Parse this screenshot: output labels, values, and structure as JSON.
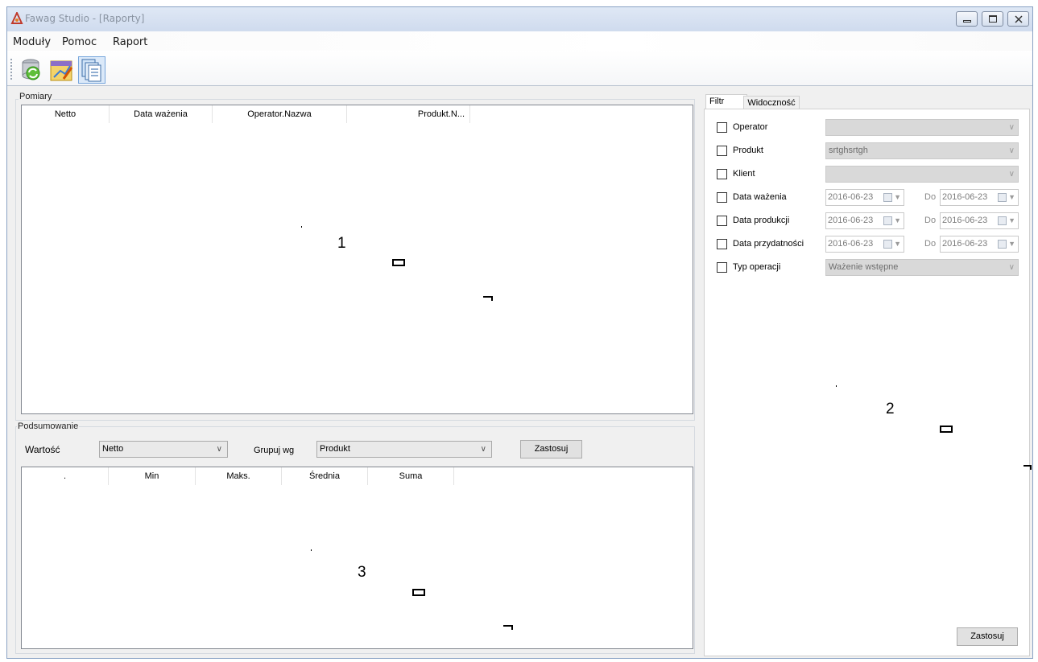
{
  "window": {
    "title": "Fawag Studio - [Raporty]"
  },
  "menu": {
    "items": [
      "Moduły",
      "Pomoc",
      "Raport"
    ]
  },
  "toolbar": {
    "buttons": [
      "refresh-db-icon",
      "report-edit-icon",
      "documents-icon"
    ]
  },
  "pomiary": {
    "title": "Pomiary",
    "columns": [
      "Netto",
      "Data ważenia",
      "Operator.Nazwa",
      "Produkt.N..."
    ]
  },
  "podsumowanie": {
    "title": "Podsumowanie",
    "wartosc_label": "Wartość",
    "wartosc_value": "Netto",
    "grupuj_label": "Grupuj wg",
    "grupuj_value": "Produkt",
    "apply_label": "Zastosuj",
    "columns": [
      ".",
      "Min",
      "Maks.",
      "Średnia",
      "Suma"
    ]
  },
  "filter": {
    "tabs": [
      "Filtr",
      "Widoczność"
    ],
    "rows": [
      {
        "label": "Operator",
        "value": ""
      },
      {
        "label": "Produkt",
        "value": "srtghsrtgh"
      },
      {
        "label": "Klient",
        "value": ""
      },
      {
        "label": "Data ważenia",
        "from": "2016-06-23",
        "to_label": "Do",
        "to": "2016-06-23"
      },
      {
        "label": "Data produkcji",
        "from": "2016-06-23",
        "to_label": "Do",
        "to": "2016-06-23"
      },
      {
        "label": "Data przydatności",
        "from": "2016-06-23",
        "to_label": "Do",
        "to": "2016-06-23"
      },
      {
        "label": "Typ operacji",
        "value": "Ważenie wstępne"
      }
    ],
    "apply_label": "Zastosuj"
  },
  "annotations": [
    "1",
    "2",
    "3"
  ]
}
